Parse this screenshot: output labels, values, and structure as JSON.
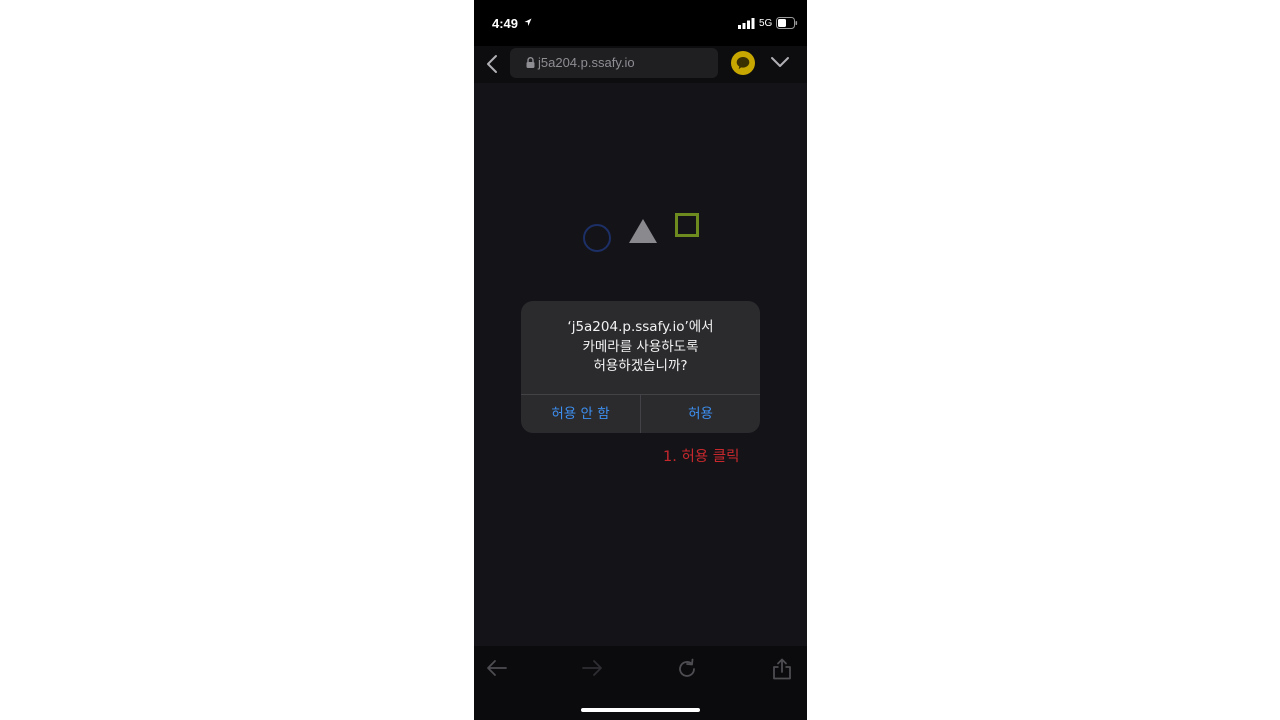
{
  "status_bar": {
    "time": "4:49",
    "network": "5G"
  },
  "browser": {
    "url": "j5a204.p.ssafy.io"
  },
  "dialog": {
    "message_lines": [
      "‘j5a204.p.ssafy.io’에서",
      "카메라를 사용하도록",
      "허용하겠습니까?"
    ],
    "deny_label": "허용 안 함",
    "allow_label": "허용"
  },
  "annotation": {
    "text": "1. 허용 클릭"
  },
  "colors": {
    "accent_button": "#3d8ff0",
    "annotation": "#c8282d",
    "circle_shape": "#1c2f66",
    "square_shape": "#6d8b1f",
    "triangle_shape": "#8a8a8e",
    "kakao_icon": "#c8a600"
  },
  "icons": {
    "back": "chevron-left-icon",
    "lock": "lock-icon",
    "extension": "kakao-talk-icon",
    "menu": "chevron-down-icon",
    "toolbar": [
      "arrow-left-icon",
      "arrow-right-icon",
      "reload-icon",
      "share-icon"
    ]
  }
}
